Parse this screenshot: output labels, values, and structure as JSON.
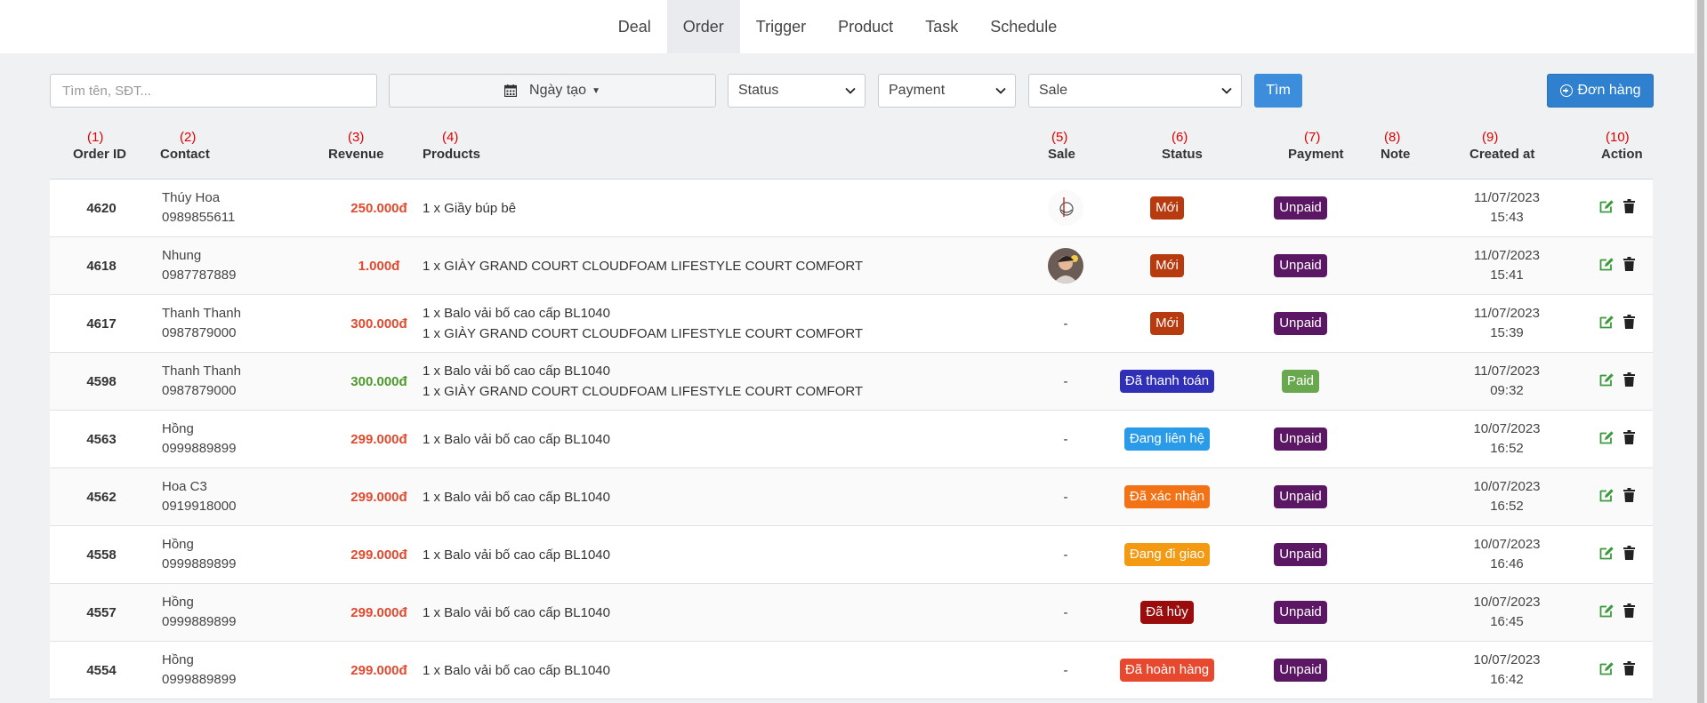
{
  "nav": {
    "tabs": [
      {
        "label": "Deal"
      },
      {
        "label": "Order"
      },
      {
        "label": "Trigger"
      },
      {
        "label": "Product"
      },
      {
        "label": "Task"
      },
      {
        "label": "Schedule"
      }
    ],
    "active": "Order"
  },
  "filters": {
    "search_placeholder": "Tìm tên, SĐT...",
    "date_label": "Ngày tạo",
    "status_label": "Status",
    "payment_label": "Payment",
    "sale_label": "Sale",
    "find_label": "Tìm",
    "new_order_label": "Đơn hàng"
  },
  "table": {
    "columns": [
      {
        "num": "(1)",
        "label": "Order ID"
      },
      {
        "num": "(2)",
        "label": "Contact"
      },
      {
        "num": "(3)",
        "label": "Revenue"
      },
      {
        "num": "(4)",
        "label": "Products"
      },
      {
        "num": "(5)",
        "label": "Sale"
      },
      {
        "num": "(6)",
        "label": "Status"
      },
      {
        "num": "(7)",
        "label": "Payment"
      },
      {
        "num": "(8)",
        "label": "Note"
      },
      {
        "num": "(9)",
        "label": "Created at"
      },
      {
        "num": "(10)",
        "label": "Action"
      }
    ],
    "rows": [
      {
        "id": "4620",
        "name": "Thúy Hoa",
        "phone": "0989855611",
        "revenue": "250.000đ",
        "revenue_color": "#e04a2f",
        "products": [
          "1 x Giầy búp bê"
        ],
        "sale": "avatar-1",
        "status": "Mới",
        "status_color": "#b83b10",
        "payment": "Unpaid",
        "payment_color": "#5b1763",
        "date": "11/07/2023",
        "time": "15:43"
      },
      {
        "id": "4618",
        "name": "Nhung",
        "phone": "0987787889",
        "revenue": "1.000đ",
        "revenue_color": "#e04a2f",
        "products": [
          "1 x GIÀY GRAND COURT CLOUDFOAM LIFESTYLE COURT COMFORT"
        ],
        "sale": "avatar-2",
        "status": "Mới",
        "status_color": "#b83b10",
        "payment": "Unpaid",
        "payment_color": "#5b1763",
        "date": "11/07/2023",
        "time": "15:41"
      },
      {
        "id": "4617",
        "name": "Thanh Thanh",
        "phone": "0987879000",
        "revenue": "300.000đ",
        "revenue_color": "#e04a2f",
        "products": [
          "1 x Balo vải bố cao cấp BL1040",
          "1 x GIÀY GRAND COURT CLOUDFOAM LIFESTYLE COURT COMFORT"
        ],
        "sale": "-",
        "status": "Mới",
        "status_color": "#b83b10",
        "payment": "Unpaid",
        "payment_color": "#5b1763",
        "date": "11/07/2023",
        "time": "15:39"
      },
      {
        "id": "4598",
        "name": "Thanh Thanh",
        "phone": "0987879000",
        "revenue": "300.000đ",
        "revenue_color": "#4c9a2a",
        "products": [
          "1 x Balo vải bố cao cấp BL1040",
          "1 x GIÀY GRAND COURT CLOUDFOAM LIFESTYLE COURT COMFORT"
        ],
        "sale": "-",
        "status": "Đã thanh toán",
        "status_color": "#2f2fb8",
        "payment": "Paid",
        "payment_color": "#6aa84f",
        "date": "11/07/2023",
        "time": "09:32"
      },
      {
        "id": "4563",
        "name": "Hồng",
        "phone": "0999889899",
        "revenue": "299.000đ",
        "revenue_color": "#e04a2f",
        "products": [
          "1 x Balo vải bố cao cấp BL1040"
        ],
        "sale": "-",
        "status": "Đang liên hệ",
        "status_color": "#2a9be8",
        "payment": "Unpaid",
        "payment_color": "#5b1763",
        "date": "10/07/2023",
        "time": "16:52"
      },
      {
        "id": "4562",
        "name": "Hoa C3",
        "phone": "0919918000",
        "revenue": "299.000đ",
        "revenue_color": "#e04a2f",
        "products": [
          "1 x Balo vải bố cao cấp BL1040"
        ],
        "sale": "-",
        "status": "Đã xác nhận",
        "status_color": "#f47216",
        "payment": "Unpaid",
        "payment_color": "#5b1763",
        "date": "10/07/2023",
        "time": "16:52"
      },
      {
        "id": "4558",
        "name": "Hồng",
        "phone": "0999889899",
        "revenue": "299.000đ",
        "revenue_color": "#e04a2f",
        "products": [
          "1 x Balo vải bố cao cấp BL1040"
        ],
        "sale": "-",
        "status": "Đang đi giao",
        "status_color": "#f39a12",
        "payment": "Unpaid",
        "payment_color": "#5b1763",
        "date": "10/07/2023",
        "time": "16:46"
      },
      {
        "id": "4557",
        "name": "Hồng",
        "phone": "0999889899",
        "revenue": "299.000đ",
        "revenue_color": "#e04a2f",
        "products": [
          "1 x Balo vải bố cao cấp BL1040"
        ],
        "sale": "-",
        "status": "Đã hủy",
        "status_color": "#9b0c0c",
        "payment": "Unpaid",
        "payment_color": "#5b1763",
        "date": "10/07/2023",
        "time": "16:45"
      },
      {
        "id": "4554",
        "name": "Hồng",
        "phone": "0999889899",
        "revenue": "299.000đ",
        "revenue_color": "#e04a2f",
        "products": [
          "1 x Balo vải bố cao cấp BL1040"
        ],
        "sale": "-",
        "status": "Đã hoàn hàng",
        "status_color": "#e8492e",
        "payment": "Unpaid",
        "payment_color": "#5b1763",
        "date": "10/07/2023",
        "time": "16:42"
      }
    ]
  },
  "colors": {
    "primary_button": "#3c8ddb",
    "edit_icon": "#3c9a3c",
    "annotation_numbers": "#e00000"
  }
}
